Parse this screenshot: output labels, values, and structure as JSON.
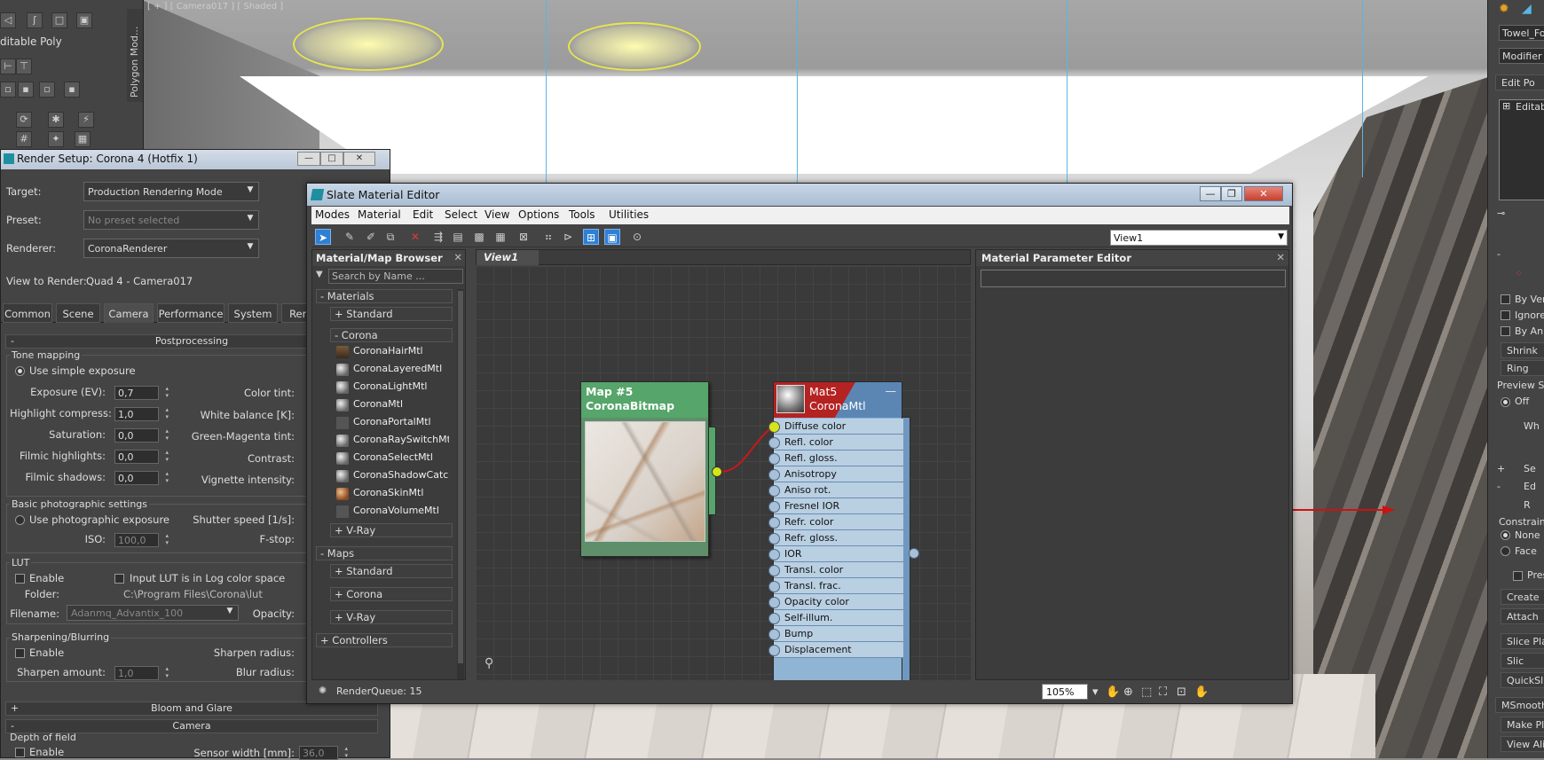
{
  "viewport": {
    "label": "[ + ] [ Camera017 ] [ Shaded ]"
  },
  "left_panel": {
    "editable_poly": "ditable Poly",
    "polygon_modeling_tab": "Polygon Mod..."
  },
  "render_setup": {
    "title": "Render Setup: Corona 4 (Hotfix 1)",
    "target_label": "Target:",
    "target_value": "Production Rendering Mode",
    "preset_label": "Preset:",
    "preset_value": "No preset selected",
    "renderer_label": "Renderer:",
    "renderer_value": "CoronaRenderer",
    "view_label": "View to Render:",
    "view_value": "Quad 4 - Camera017",
    "tabs": [
      "Common",
      "Scene",
      "Camera",
      "Performance",
      "System",
      "Ren"
    ],
    "postprocessing": "Postprocessing",
    "tone_mapping": "Tone mapping",
    "use_simple_exposure": "Use simple exposure",
    "exposure_label": "Exposure (EV):",
    "exposure_value": "0,7",
    "highlight_label": "Highlight compress:",
    "highlight_value": "1,0",
    "saturation_label": "Saturation:",
    "saturation_value": "0,0",
    "filmic_highlights_label": "Filmic highlights:",
    "filmic_highlights_value": "0,0",
    "filmic_shadows_label": "Filmic shadows:",
    "filmic_shadows_value": "0,0",
    "color_tint_label": "Color tint:",
    "white_balance_label": "White balance [K]:",
    "green_magenta_label": "Green-Magenta tint:",
    "contrast_label": "Contrast:",
    "vignette_label": "Vignette intensity:",
    "basic_photo": "Basic photographic settings",
    "use_photo_exposure": "Use photographic exposure",
    "shutter_label": "Shutter speed [1/s]:",
    "iso_label": "ISO:",
    "iso_value": "100,0",
    "fstop_label": "F-stop:",
    "lut": "LUT",
    "lut_enable": "Enable",
    "lut_log": "Input LUT is in Log color space",
    "folder_label": "Folder:",
    "folder_value": "C:\\Program Files\\Corona\\lut",
    "filename_label": "Filename:",
    "filename_value": "Adanmq_Advantix_100",
    "opacity_label": "Opacity:",
    "sharpening": "Sharpening/Blurring",
    "sharp_enable": "Enable",
    "sharpen_radius_label": "Sharpen radius:",
    "sharpen_amount_label": "Sharpen amount:",
    "sharpen_amount_value": "1,0",
    "blur_radius_label": "Blur radius:",
    "bloom_glare": "Bloom and Glare",
    "camera": "Camera",
    "dof": "Depth of field",
    "dof_enable": "Enable",
    "sensor_label": "Sensor width [mm]:",
    "sensor_value": "36,0"
  },
  "sme": {
    "title": "Slate Material Editor",
    "menu": [
      "Modes",
      "Material",
      "Edit",
      "Select",
      "View",
      "Options",
      "Tools",
      "Utilities"
    ],
    "view_select": "View1",
    "browser": {
      "title": "Material/Map Browser",
      "search_placeholder": "Search by Name ...",
      "materials": "- Materials",
      "standard": "+ Standard",
      "corona": "- Corona",
      "items": [
        "CoronaHairMtl",
        "CoronaLayeredMtl",
        "CoronaLightMtl",
        "CoronaMtl",
        "CoronaPortalMtl",
        "CoronaRaySwitchMtl",
        "CoronaSelectMtl",
        "CoronaShadowCatc...",
        "CoronaSkinMtl",
        "CoronaVolumeMtl"
      ],
      "vray": "+ V-Ray",
      "maps": "- Maps",
      "maps_standard": "+ Standard",
      "maps_corona": "+ Corona",
      "maps_vray": "+ V-Ray",
      "controllers": "+ Controllers"
    },
    "view_tab": "View1",
    "map_node": {
      "line1": "Map #5",
      "line2": "CoronaBitmap"
    },
    "mtl_node": {
      "line1": "Mat5",
      "line2": "CoronaMtl",
      "slots": [
        "Diffuse color",
        "Refl. color",
        "Refl. gloss.",
        "Anisotropy",
        "Aniso rot.",
        "Fresnel IOR",
        "Refr. color",
        "Refr. gloss.",
        "IOR",
        "Transl. color",
        "Transl. frac.",
        "Opacity color",
        "Self-illum.",
        "Bump",
        "Displacement"
      ]
    },
    "param_editor": "Material Parameter Editor",
    "status": "RenderQueue: 15",
    "zoom": "105%"
  },
  "right_panel": {
    "object_name": "Towel_Fol",
    "modifier_list": "Modifier Li",
    "edit_poly": "Edit Po",
    "editable": "Editab",
    "by_vertex": "By Ver",
    "ignore": "Ignore",
    "by_angle": "By An",
    "shrink": "Shrink",
    "ring": "Ring",
    "preview_s": "Preview S",
    "off": "Off",
    "wh": "Wh",
    "se": "Se",
    "ed": "Ed",
    "r": "R",
    "constrain": "Constrain",
    "none": "None",
    "face": "Face",
    "pres": "Pres",
    "create": "Create",
    "attach": "Attach",
    "slice_plane": "Slice Pla",
    "slice": "Slic",
    "quickslice": "QuickSl",
    "msmooth": "MSmooth",
    "make_planar": "Make Pl",
    "view_align": "View Ali"
  }
}
